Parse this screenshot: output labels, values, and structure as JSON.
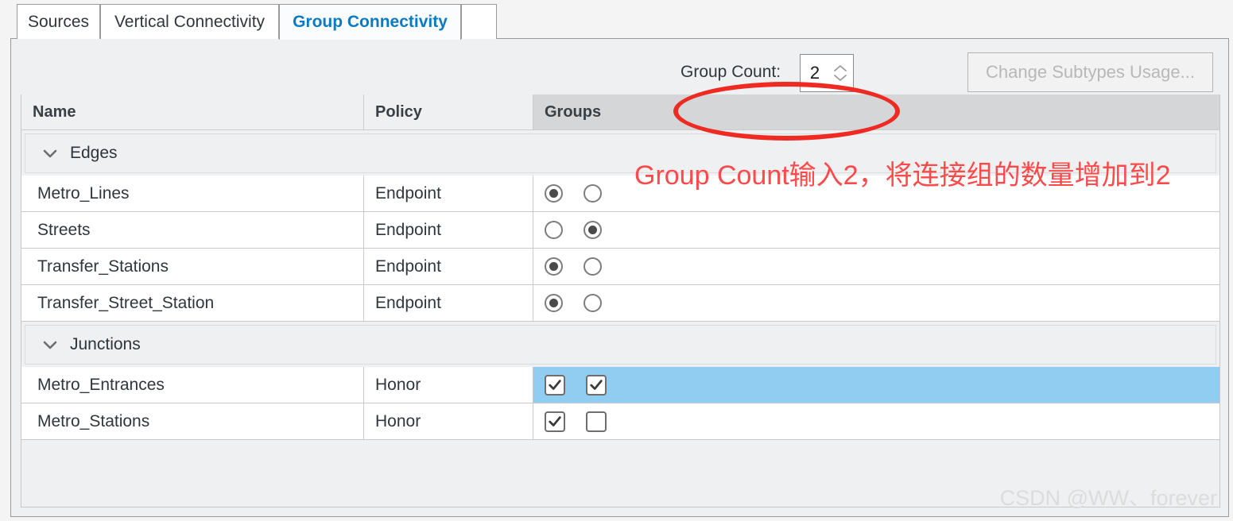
{
  "tabs": [
    {
      "label": "Sources",
      "active": false
    },
    {
      "label": "Vertical Connectivity",
      "active": false
    },
    {
      "label": "Group Connectivity",
      "active": true
    }
  ],
  "toolbar": {
    "group_count_label": "Group Count:",
    "group_count_value": "2",
    "spinner_up_icon": "chevron-up-icon",
    "spinner_down_icon": "chevron-down-icon",
    "change_subtypes_label": "Change Subtypes Usage..."
  },
  "table": {
    "columns": [
      "Name",
      "Policy",
      "Groups"
    ],
    "sections": [
      {
        "label": "Edges",
        "chevron_icon": "chevron-down-icon",
        "control_type": "radio",
        "rows": [
          {
            "name": "Metro_Lines",
            "policy": "Endpoint",
            "groups": [
              true,
              false
            ],
            "selected": false
          },
          {
            "name": "Streets",
            "policy": "Endpoint",
            "groups": [
              false,
              true
            ],
            "selected": false
          },
          {
            "name": "Transfer_Stations",
            "policy": "Endpoint",
            "groups": [
              true,
              false
            ],
            "selected": false
          },
          {
            "name": "Transfer_Street_Station",
            "policy": "Endpoint",
            "groups": [
              true,
              false
            ],
            "selected": false
          }
        ]
      },
      {
        "label": "Junctions",
        "chevron_icon": "chevron-down-icon",
        "control_type": "checkbox",
        "rows": [
          {
            "name": "Metro_Entrances",
            "policy": "Honor",
            "groups": [
              true,
              true
            ],
            "selected": true
          },
          {
            "name": "Metro_Stations",
            "policy": "Honor",
            "groups": [
              true,
              false
            ],
            "selected": false
          }
        ]
      }
    ]
  },
  "annotations": {
    "ellipse_target": "group-count-spinner",
    "note_text": "Group Count输入2，将连接组的数量增加到2",
    "note_color": "#fe4a4a",
    "ellipse_color": "#ee2a22"
  },
  "watermark": {
    "text": "CSDN @WW、forever"
  },
  "colors": {
    "active_tab_text": "#0a7ac4",
    "selection_blue": "#90cdf0",
    "panel_background": "#eef0f1",
    "header_groups_background": "#d4d6d7"
  }
}
